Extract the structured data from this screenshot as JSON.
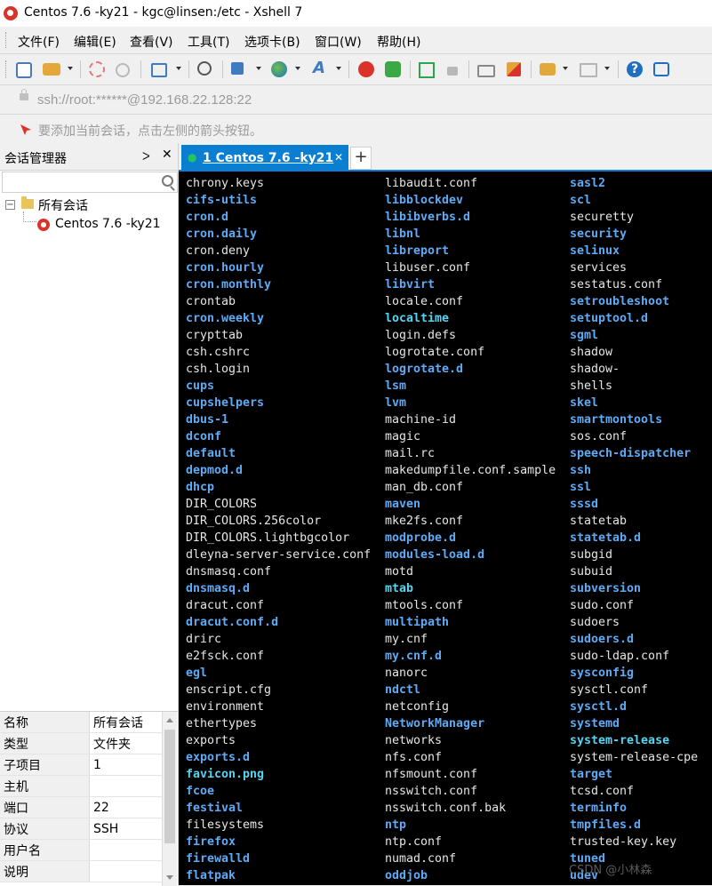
{
  "window": {
    "title": "Centos 7.6 -ky21 - kgc@linsen:/etc - Xshell 7"
  },
  "menu": [
    "文件(F)",
    "编辑(E)",
    "查看(V)",
    "工具(T)",
    "选项卡(B)",
    "窗口(W)",
    "帮助(H)"
  ],
  "toolbar": {
    "icons": [
      "new-session-icon",
      "open-folder-icon",
      "reconnect-icon",
      "disconnect-icon",
      "properties-icon",
      "find-icon",
      "transfer-icon",
      "globe-icon",
      "font-icon",
      "xshell-icon",
      "xftp-icon",
      "fullscreen-icon",
      "lock-icon",
      "keyboard-icon",
      "highlight-icon",
      "add-tab-icon",
      "layout-icon",
      "help-icon",
      "chat-icon"
    ],
    "colors": {
      "accent": "#0a7fd1",
      "xshell": "#d9332a",
      "xftp": "#3aa845"
    }
  },
  "address": {
    "value": "ssh://root:******@192.168.22.128:22"
  },
  "hint": {
    "text": "要添加当前会话，点击左侧的箭头按钮。"
  },
  "session_manager": {
    "title": "会话管理器",
    "pin_icon": "pin-icon",
    "close_icon": "close-icon",
    "search_placeholder": "",
    "tree": {
      "root_toggle": "−",
      "root": "所有会话",
      "child": "Centos 7.6 -ky21"
    }
  },
  "properties": [
    {
      "key": "名称",
      "value": "所有会话"
    },
    {
      "key": "类型",
      "value": "文件夹"
    },
    {
      "key": "子项目",
      "value": "1"
    },
    {
      "key": "主机",
      "value": ""
    },
    {
      "key": "端口",
      "value": "22"
    },
    {
      "key": "协议",
      "value": "SSH"
    },
    {
      "key": "用户名",
      "value": ""
    },
    {
      "key": "说明",
      "value": ""
    }
  ],
  "tabs": {
    "active_label": "1 Centos 7.6 -ky21",
    "status_icon": "●",
    "close": "✕",
    "new_tab": "+"
  },
  "terminal": {
    "colors": {
      "file": "#e6e6e6",
      "dir": "#5eaaf5",
      "link": "#58d3f1",
      "background": "#000000"
    },
    "columns": [
      [
        {
          "name": "chrony.keys",
          "type": "file"
        },
        {
          "name": "cifs-utils",
          "type": "dir"
        },
        {
          "name": "cron.d",
          "type": "dir"
        },
        {
          "name": "cron.daily",
          "type": "dir"
        },
        {
          "name": "cron.deny",
          "type": "file"
        },
        {
          "name": "cron.hourly",
          "type": "dir"
        },
        {
          "name": "cron.monthly",
          "type": "dir"
        },
        {
          "name": "crontab",
          "type": "file"
        },
        {
          "name": "cron.weekly",
          "type": "dir"
        },
        {
          "name": "crypttab",
          "type": "file"
        },
        {
          "name": "csh.cshrc",
          "type": "file"
        },
        {
          "name": "csh.login",
          "type": "file"
        },
        {
          "name": "cups",
          "type": "dir"
        },
        {
          "name": "cupshelpers",
          "type": "dir"
        },
        {
          "name": "dbus-1",
          "type": "dir"
        },
        {
          "name": "dconf",
          "type": "dir"
        },
        {
          "name": "default",
          "type": "dir"
        },
        {
          "name": "depmod.d",
          "type": "dir"
        },
        {
          "name": "dhcp",
          "type": "dir"
        },
        {
          "name": "DIR_COLORS",
          "type": "file"
        },
        {
          "name": "DIR_COLORS.256color",
          "type": "file"
        },
        {
          "name": "DIR_COLORS.lightbgcolor",
          "type": "file"
        },
        {
          "name": "dleyna-server-service.conf",
          "type": "file"
        },
        {
          "name": "dnsmasq.conf",
          "type": "file"
        },
        {
          "name": "dnsmasq.d",
          "type": "dir"
        },
        {
          "name": "dracut.conf",
          "type": "file"
        },
        {
          "name": "dracut.conf.d",
          "type": "dir"
        },
        {
          "name": "drirc",
          "type": "file"
        },
        {
          "name": "e2fsck.conf",
          "type": "file"
        },
        {
          "name": "egl",
          "type": "dir"
        },
        {
          "name": "enscript.cfg",
          "type": "file"
        },
        {
          "name": "environment",
          "type": "file"
        },
        {
          "name": "ethertypes",
          "type": "file"
        },
        {
          "name": "exports",
          "type": "file"
        },
        {
          "name": "exports.d",
          "type": "dir"
        },
        {
          "name": "favicon.png",
          "type": "link"
        },
        {
          "name": "fcoe",
          "type": "dir"
        },
        {
          "name": "festival",
          "type": "dir"
        },
        {
          "name": "filesystems",
          "type": "file"
        },
        {
          "name": "firefox",
          "type": "dir"
        },
        {
          "name": "firewalld",
          "type": "dir"
        },
        {
          "name": "flatpak",
          "type": "dir"
        }
      ],
      [
        {
          "name": "libaudit.conf",
          "type": "file"
        },
        {
          "name": "libblockdev",
          "type": "dir"
        },
        {
          "name": "libibverbs.d",
          "type": "dir"
        },
        {
          "name": "libnl",
          "type": "dir"
        },
        {
          "name": "libreport",
          "type": "dir"
        },
        {
          "name": "libuser.conf",
          "type": "file"
        },
        {
          "name": "libvirt",
          "type": "dir"
        },
        {
          "name": "locale.conf",
          "type": "file"
        },
        {
          "name": "localtime",
          "type": "link"
        },
        {
          "name": "login.defs",
          "type": "file"
        },
        {
          "name": "logrotate.conf",
          "type": "file"
        },
        {
          "name": "logrotate.d",
          "type": "dir"
        },
        {
          "name": "lsm",
          "type": "dir"
        },
        {
          "name": "lvm",
          "type": "dir"
        },
        {
          "name": "machine-id",
          "type": "file"
        },
        {
          "name": "magic",
          "type": "file"
        },
        {
          "name": "mail.rc",
          "type": "file"
        },
        {
          "name": "makedumpfile.conf.sample",
          "type": "file"
        },
        {
          "name": "man_db.conf",
          "type": "file"
        },
        {
          "name": "maven",
          "type": "dir"
        },
        {
          "name": "mke2fs.conf",
          "type": "file"
        },
        {
          "name": "modprobe.d",
          "type": "dir"
        },
        {
          "name": "modules-load.d",
          "type": "dir"
        },
        {
          "name": "motd",
          "type": "file"
        },
        {
          "name": "mtab",
          "type": "link"
        },
        {
          "name": "mtools.conf",
          "type": "file"
        },
        {
          "name": "multipath",
          "type": "dir"
        },
        {
          "name": "my.cnf",
          "type": "file"
        },
        {
          "name": "my.cnf.d",
          "type": "dir"
        },
        {
          "name": "nanorc",
          "type": "file"
        },
        {
          "name": "ndctl",
          "type": "dir"
        },
        {
          "name": "netconfig",
          "type": "file"
        },
        {
          "name": "NetworkManager",
          "type": "dir"
        },
        {
          "name": "networks",
          "type": "file"
        },
        {
          "name": "nfs.conf",
          "type": "file"
        },
        {
          "name": "nfsmount.conf",
          "type": "file"
        },
        {
          "name": "nsswitch.conf",
          "type": "file"
        },
        {
          "name": "nsswitch.conf.bak",
          "type": "file"
        },
        {
          "name": "ntp",
          "type": "dir"
        },
        {
          "name": "ntp.conf",
          "type": "file"
        },
        {
          "name": "numad.conf",
          "type": "file"
        },
        {
          "name": "oddjob",
          "type": "dir"
        }
      ],
      [
        {
          "name": "sasl2",
          "type": "dir"
        },
        {
          "name": "scl",
          "type": "dir"
        },
        {
          "name": "securetty",
          "type": "file"
        },
        {
          "name": "security",
          "type": "dir"
        },
        {
          "name": "selinux",
          "type": "dir"
        },
        {
          "name": "services",
          "type": "file"
        },
        {
          "name": "sestatus.conf",
          "type": "file"
        },
        {
          "name": "setroubleshoot",
          "type": "dir"
        },
        {
          "name": "setuptool.d",
          "type": "dir"
        },
        {
          "name": "sgml",
          "type": "dir"
        },
        {
          "name": "shadow",
          "type": "file"
        },
        {
          "name": "shadow-",
          "type": "file"
        },
        {
          "name": "shells",
          "type": "file"
        },
        {
          "name": "skel",
          "type": "dir"
        },
        {
          "name": "smartmontools",
          "type": "dir"
        },
        {
          "name": "sos.conf",
          "type": "file"
        },
        {
          "name": "speech-dispatcher",
          "type": "dir"
        },
        {
          "name": "ssh",
          "type": "dir"
        },
        {
          "name": "ssl",
          "type": "dir"
        },
        {
          "name": "sssd",
          "type": "dir"
        },
        {
          "name": "statetab",
          "type": "file"
        },
        {
          "name": "statetab.d",
          "type": "dir"
        },
        {
          "name": "subgid",
          "type": "file"
        },
        {
          "name": "subuid",
          "type": "file"
        },
        {
          "name": "subversion",
          "type": "dir"
        },
        {
          "name": "sudo.conf",
          "type": "file"
        },
        {
          "name": "sudoers",
          "type": "file"
        },
        {
          "name": "sudoers.d",
          "type": "dir"
        },
        {
          "name": "sudo-ldap.conf",
          "type": "file"
        },
        {
          "name": "sysconfig",
          "type": "dir"
        },
        {
          "name": "sysctl.conf",
          "type": "file"
        },
        {
          "name": "sysctl.d",
          "type": "dir"
        },
        {
          "name": "systemd",
          "type": "dir"
        },
        {
          "name": "system-release",
          "type": "link"
        },
        {
          "name": "system-release-cpe",
          "type": "file"
        },
        {
          "name": "target",
          "type": "dir"
        },
        {
          "name": "tcsd.conf",
          "type": "file"
        },
        {
          "name": "terminfo",
          "type": "dir"
        },
        {
          "name": "tmpfiles.d",
          "type": "dir"
        },
        {
          "name": "trusted-key.key",
          "type": "file"
        },
        {
          "name": "tuned",
          "type": "dir"
        },
        {
          "name": "udev",
          "type": "dir"
        }
      ]
    ]
  },
  "watermark": {
    "text": "CSDN @小林森"
  }
}
